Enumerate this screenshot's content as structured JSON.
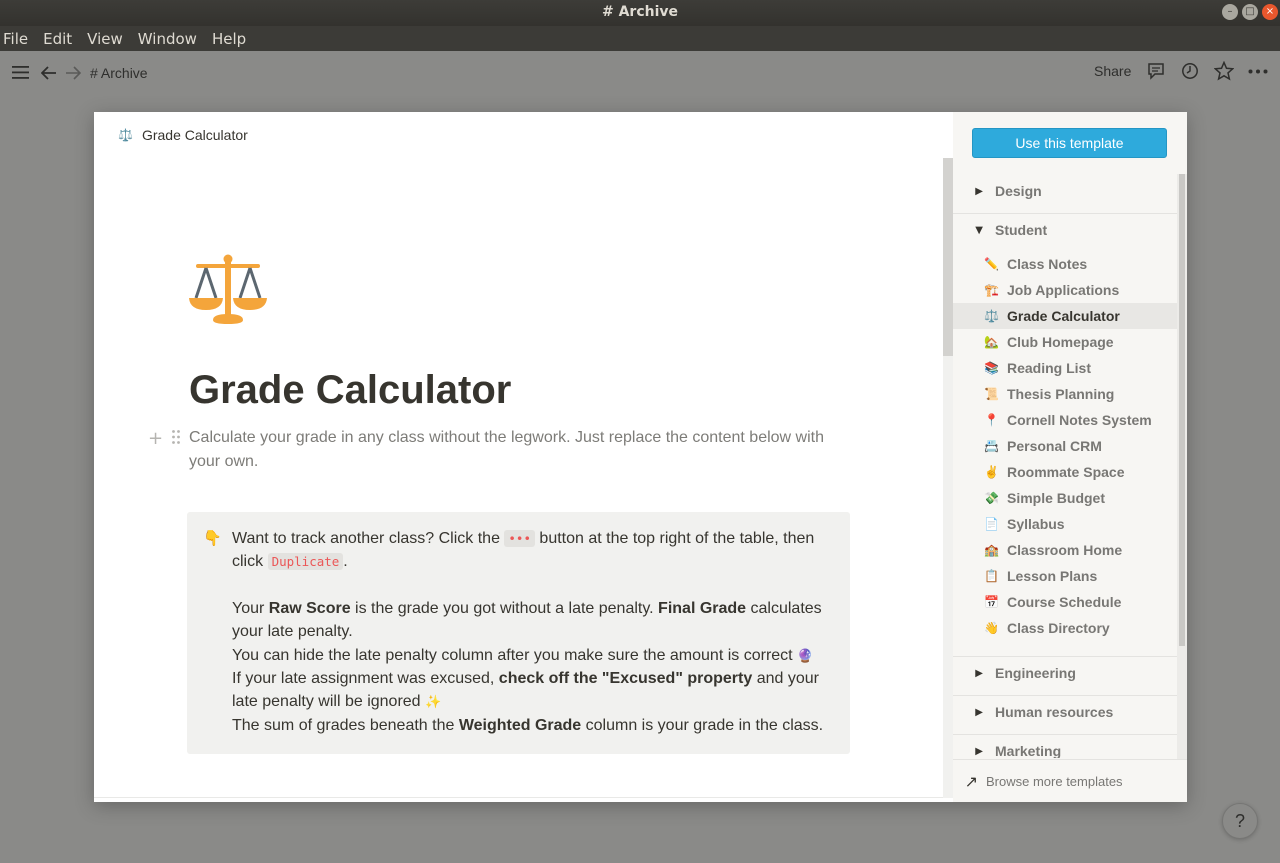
{
  "window": {
    "title": "# Archive",
    "controls": {
      "minimize": "–",
      "maximize": "□",
      "close": "×"
    }
  },
  "menu": [
    "File",
    "Edit",
    "View",
    "Window",
    "Help"
  ],
  "toolbar": {
    "breadcrumb": "# Archive",
    "share_label": "Share"
  },
  "preview": {
    "header_icon": "⚖️",
    "header_title": "Grade Calculator",
    "page_title": "Grade Calculator",
    "subtitle": "Calculate your grade in any class without the legwork. Just replace the content below with your own.",
    "callout": {
      "icon": "👇",
      "line1_a": "Want to track another class? Click the ",
      "line1_code": "•••",
      "line1_b": " button at the top right of the table, then click ",
      "line1_code2": "Duplicate",
      "line1_c": ".",
      "p2_a": "Your ",
      "p2_bold1": "Raw Score",
      "p2_b": " is the grade you got without a late penalty. ",
      "p2_bold2": "Final Grade",
      "p2_c": " calculates your late penalty.",
      "p3": "You can hide the late penalty column after you make sure the amount is correct",
      "p3_emoji": "🔮",
      "p4_a": "If your late assignment was excused, ",
      "p4_bold": "check off the \"Excused\" property",
      "p4_b": " and your late penalty will be ignored",
      "p4_emoji": "✨",
      "p5_a": "The sum of grades beneath the ",
      "p5_bold": "Weighted Grade",
      "p5_b": " column is your grade in the class."
    }
  },
  "sidebar": {
    "use_template_label": "Use this template",
    "categories": {
      "design": "Design",
      "student": "Student",
      "engineering": "Engineering",
      "human_resources": "Human resources",
      "marketing": "Marketing"
    },
    "student_items": [
      {
        "icon": "✏️",
        "label": "Class Notes"
      },
      {
        "icon": "🏗️",
        "label": "Job Applications"
      },
      {
        "icon": "⚖️",
        "label": "Grade Calculator",
        "active": true
      },
      {
        "icon": "🏡",
        "label": "Club Homepage"
      },
      {
        "icon": "📚",
        "label": "Reading List"
      },
      {
        "icon": "📜",
        "label": "Thesis Planning"
      },
      {
        "icon": "📍",
        "label": "Cornell Notes System"
      },
      {
        "icon": "📇",
        "label": "Personal CRM"
      },
      {
        "icon": "✌️",
        "label": "Roommate Space"
      },
      {
        "icon": "💸",
        "label": "Simple Budget"
      },
      {
        "icon": "📄",
        "label": "Syllabus"
      },
      {
        "icon": "🏫",
        "label": "Classroom Home"
      },
      {
        "icon": "📋",
        "label": "Lesson Plans"
      },
      {
        "icon": "📅",
        "label": "Course Schedule"
      },
      {
        "icon": "👋",
        "label": "Class Directory"
      }
    ],
    "footer_label": "Browse more templates"
  },
  "help_label": "?"
}
